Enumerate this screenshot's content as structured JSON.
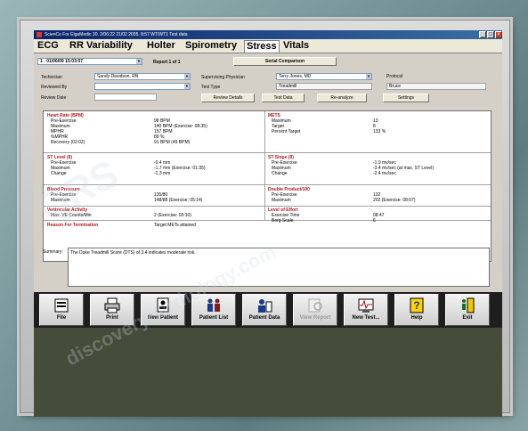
{
  "window": {
    "title": "ScienCe For ElgaMedic   30. 2/06:22  21/02   2005. 8:57 WT/WT1   Test data"
  },
  "tabs": [
    "ECG",
    "RR Variability",
    "Holter",
    "Spirometry",
    "Stress",
    "Vitals"
  ],
  "active_tab": "Stress",
  "toolbar_row": {
    "test_selector": "1 - 01/06/09 15:03:57",
    "report": "Report 1 of 1",
    "serial_button": "Serial Comparison"
  },
  "form": {
    "technician_label": "Technician",
    "technician_value": "Sandy Davidson, RN",
    "reviewed_by_label": "Reviewed By",
    "reviewed_by_value": "",
    "review_date_label": "Review Date",
    "review_date_value": "",
    "physician_label": "Supervising Physician",
    "physician_value": "Terry Jones, MD",
    "test_type_label": "Test Type",
    "test_type_value": "Treadmill",
    "protocol_label": "Protocol",
    "protocol_value": "Bruce",
    "buttons": [
      "Review Details",
      "Test Data",
      "Re-analyze",
      "Settings"
    ]
  },
  "sections": {
    "heart_rate": {
      "title": "Heart Rate (BPM)",
      "labels": [
        "Pre-Exercise",
        "Maximum",
        "MPHR",
        "%MPHR",
        "Recovery (02:02)"
      ],
      "values": [
        "98 BPM",
        "140 BPM (Exercise: 08:35)",
        "157 BPM",
        "89 %",
        "91 BPM (49 BPM)"
      ]
    },
    "mets": {
      "title": "METS",
      "labels": [
        "Maximum",
        "Target",
        "Percent Target"
      ],
      "values": [
        "13",
        "8",
        "133 %"
      ]
    },
    "st_level": {
      "title": "ST Level (II)",
      "labels": [
        "Pre-Exercise",
        "Maximum",
        "Change"
      ],
      "values": [
        "-0.4 mm",
        "-1.7 mm (Exercise: 01:35)",
        "-1.3 mm"
      ]
    },
    "st_slope": {
      "title": "ST Slope (II)",
      "labels": [
        "Pre-Exercise",
        "Maximum",
        "Change"
      ],
      "values": [
        "-1.0 mv/sec",
        "-3.4 mv/sec (at max. ST Level)",
        "-2.4 mv/sec"
      ]
    },
    "blood_pressure": {
      "title": "Blood Pressure",
      "labels": [
        "Pre-Exercise",
        "Maximum"
      ],
      "values": [
        "135/80",
        "148/88 (Exercise: 05:14)"
      ]
    },
    "double_product": {
      "title": "Double Product/100",
      "labels": [
        "Pre-Exercise",
        "Maximum"
      ],
      "values": [
        "132",
        "202 (Exercise: 08:07)"
      ]
    },
    "ventricular": {
      "title": "Ventricular Activity",
      "labels": [
        "Max. VE Counts/Min"
      ],
      "values": [
        "2 (Exercise: 05:10)"
      ]
    },
    "effort": {
      "title": "Level of Effort",
      "labels": [
        "Exercise Time",
        "Borg Scale"
      ],
      "values": [
        "08:47",
        "6"
      ]
    },
    "termination": {
      "title": "Reason For Termination",
      "value": "Target METs attained"
    }
  },
  "summary": {
    "label": "Summary:",
    "text": "The Duke Treadmill Score (DTS) of 3.4 indicates moderate risk."
  },
  "toolbar": [
    {
      "label": "File",
      "icon": "printer-file-icon",
      "enabled": true
    },
    {
      "label": "Print",
      "icon": "printer-icon",
      "enabled": true
    },
    {
      "label": "New Patient",
      "icon": "new-patient-icon",
      "enabled": true
    },
    {
      "label": "Patient List",
      "icon": "patient-list-icon",
      "enabled": true
    },
    {
      "label": "Patient Data",
      "icon": "patient-data-icon",
      "enabled": true
    },
    {
      "label": "View Report",
      "icon": "view-report-icon",
      "enabled": false
    },
    {
      "label": "New Test...",
      "icon": "new-test-icon",
      "enabled": true
    },
    {
      "label": "Help",
      "icon": "help-icon",
      "enabled": true
    },
    {
      "label": "Exit",
      "icon": "exit-icon",
      "enabled": true
    }
  ],
  "colors": {
    "section_title": "#b01818",
    "titlebar": "#0a246a",
    "toolbar_bg": "#1e1e1e",
    "lower_panel": "#454c3a"
  }
}
